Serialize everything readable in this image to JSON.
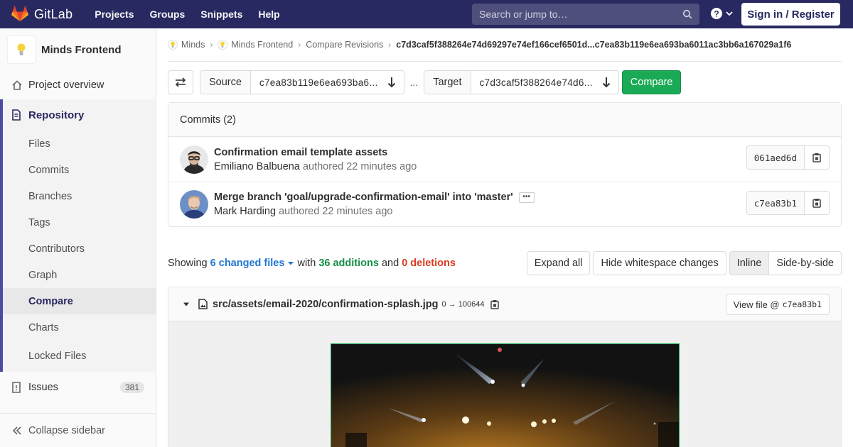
{
  "navbar": {
    "brand": "GitLab",
    "links": [
      "Projects",
      "Groups",
      "Snippets",
      "Help"
    ],
    "search_placeholder": "Search or jump to…",
    "signin": "Sign in / Register"
  },
  "sidebar": {
    "project_name": "Minds Frontend",
    "overview": "Project overview",
    "repository": "Repository",
    "repo_items": [
      "Files",
      "Commits",
      "Branches",
      "Tags",
      "Contributors",
      "Graph",
      "Compare",
      "Charts",
      "Locked Files"
    ],
    "issues": "Issues",
    "issues_count": "381",
    "collapse": "Collapse sidebar"
  },
  "breadcrumb": {
    "items": [
      "Minds",
      "Minds Frontend",
      "Compare Revisions"
    ],
    "current": "c7d3caf5f388264e74d69297e74ef166cef6501d...c7ea83b119e6ea693ba6011ac3bb6a167029a1f6"
  },
  "compare": {
    "source_label": "Source",
    "source_value": "c7ea83b119e6ea693ba6...",
    "dots": "...",
    "target_label": "Target",
    "target_value": "c7d3caf5f388264e74d6...",
    "button": "Compare"
  },
  "commits": {
    "header": "Commits (2)",
    "items": [
      {
        "title": "Confirmation email template assets",
        "author": "Emiliano Balbuena",
        "meta": "authored 22 minutes ago",
        "sha": "061aed6d"
      },
      {
        "title": "Merge branch 'goal/upgrade-confirmation-email' into 'master'",
        "author": "Mark Harding",
        "meta": "authored 22 minutes ago",
        "sha": "c7ea83b1",
        "ellipsis": "•••"
      }
    ]
  },
  "diff": {
    "showing": "Showing",
    "changed_files": "6 changed files",
    "with": "with",
    "additions": "36 additions",
    "and": "and",
    "deletions": "0 deletions",
    "expand_all": "Expand all",
    "hide_whitespace": "Hide whitespace changes",
    "inline": "Inline",
    "side_by_side": "Side-by-side"
  },
  "file": {
    "path": "src/assets/email-2020/confirmation-splash.jpg",
    "mode": "0 → 100644",
    "view_file": "View file @",
    "view_sha": "c7ea83b1"
  }
}
